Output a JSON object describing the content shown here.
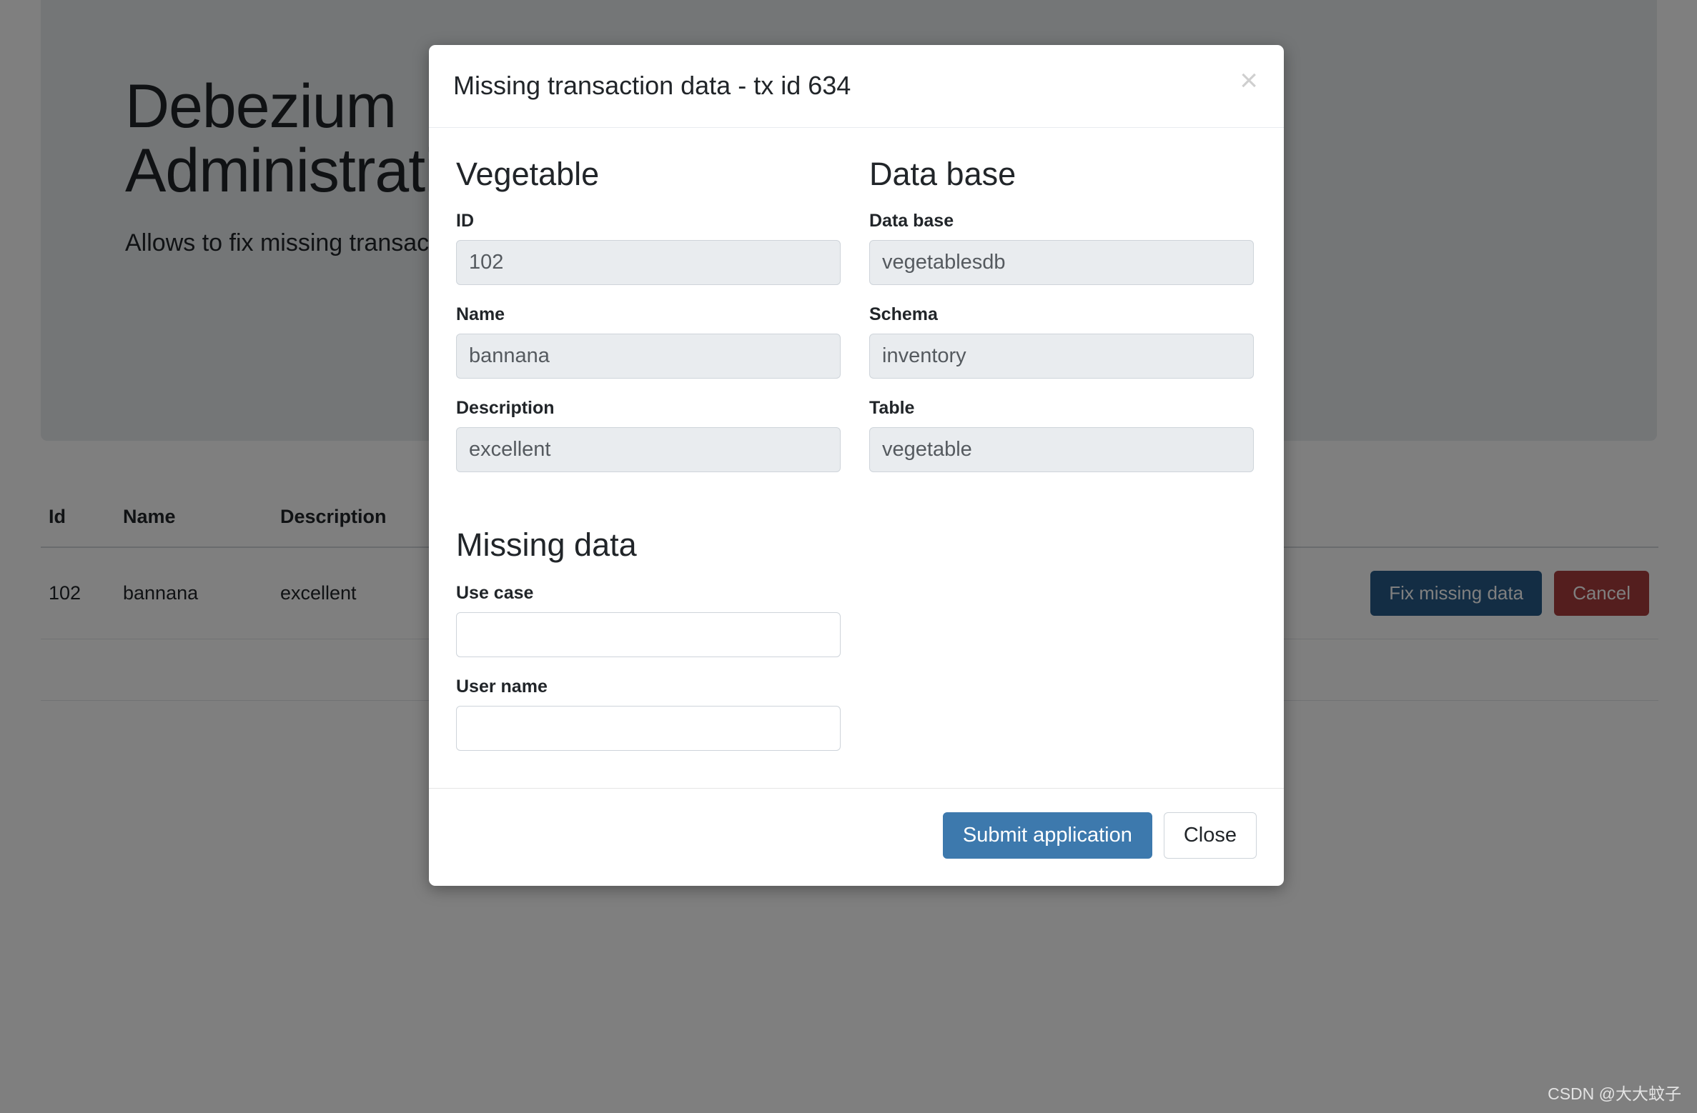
{
  "background_page": {
    "jumbotron": {
      "title": "Debezium\nAdministration",
      "subtitle": "Allows to fix missing transaction data"
    },
    "table": {
      "headers": {
        "id": "Id",
        "name": "Name",
        "description": "Description"
      },
      "rows": [
        {
          "id": "102",
          "name": "bannana",
          "description": "excellent",
          "fix_button": "Fix missing data",
          "cancel_button": "Cancel"
        }
      ]
    }
  },
  "modal": {
    "title": "Missing transaction data - tx id 634",
    "close_icon": "×",
    "sections": {
      "vegetable": {
        "heading": "Vegetable",
        "fields": [
          {
            "label": "ID",
            "value": "102",
            "disabled": true
          },
          {
            "label": "Name",
            "value": "bannana",
            "disabled": true
          },
          {
            "label": "Description",
            "value": "excellent",
            "disabled": true
          }
        ]
      },
      "database": {
        "heading": "Data base",
        "fields": [
          {
            "label": "Data base",
            "value": "vegetablesdb",
            "disabled": true
          },
          {
            "label": "Schema",
            "value": "inventory",
            "disabled": true
          },
          {
            "label": "Table",
            "value": "vegetable",
            "disabled": true
          }
        ]
      },
      "missing_data": {
        "heading": "Missing data",
        "fields": [
          {
            "label": "Use case",
            "value": "",
            "disabled": false
          },
          {
            "label": "User name",
            "value": "",
            "disabled": false
          }
        ]
      }
    },
    "footer": {
      "submit_label": "Submit application",
      "close_label": "Close"
    }
  },
  "watermark": "CSDN @大大蚊子",
  "colors": {
    "submit_blue": "#3d79ad",
    "fix_button_blue": "#265a88",
    "cancel_red": "#a93d3d",
    "disabled_input_bg": "#e9ecef",
    "input_border": "#ced4da",
    "jumbotron_bg": "#e9ecef"
  }
}
